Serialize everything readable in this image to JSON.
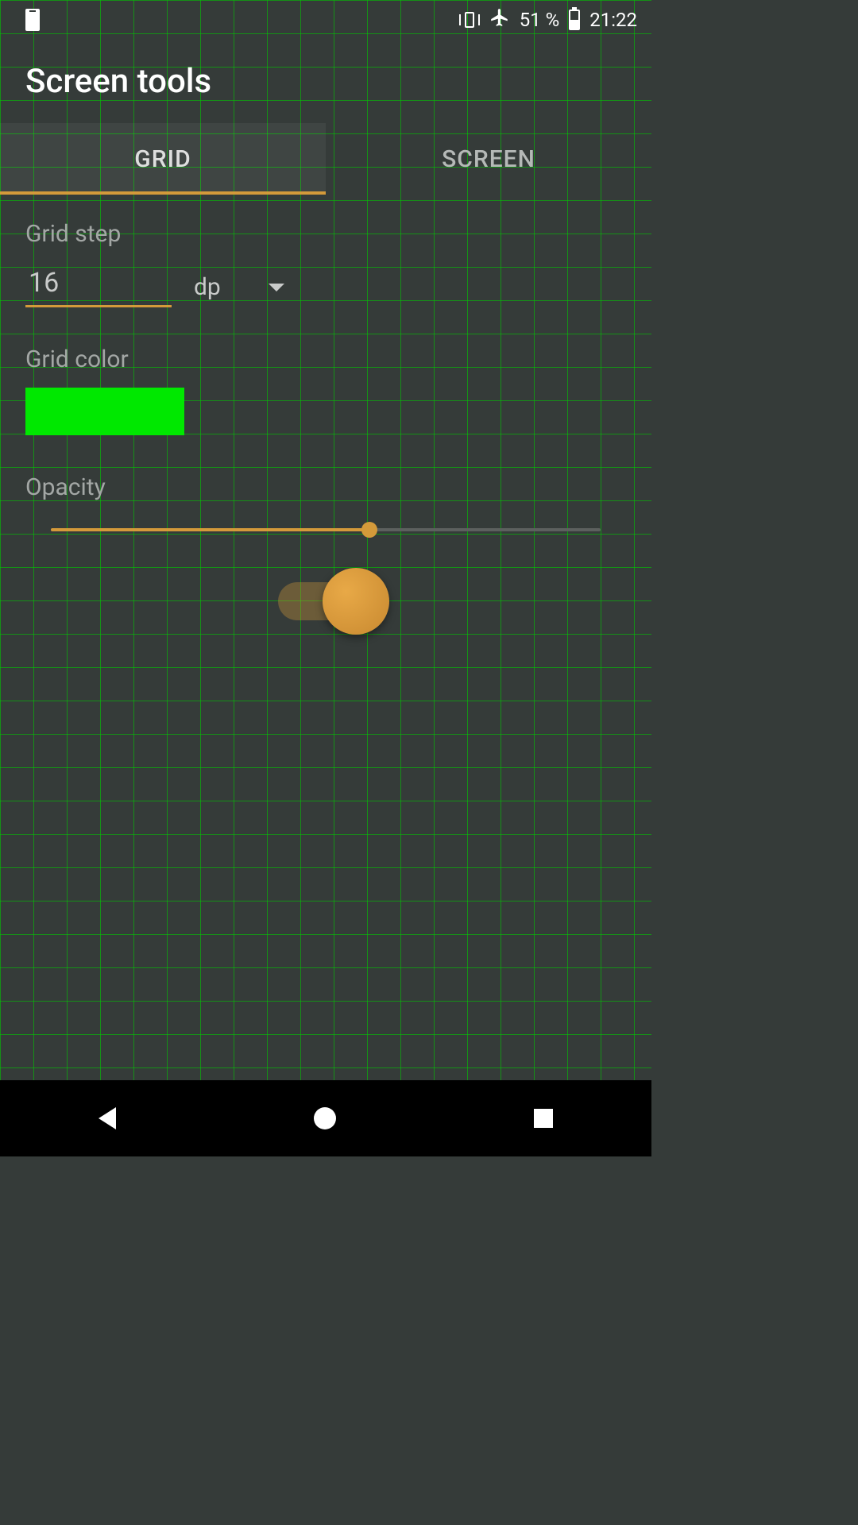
{
  "status_bar": {
    "battery_percent": "51 %",
    "time": "21:22"
  },
  "header": {
    "title": "Screen tools"
  },
  "tabs": [
    {
      "label": "GRID",
      "active": true
    },
    {
      "label": "SCREEN",
      "active": false
    }
  ],
  "grid_step": {
    "label": "Grid step",
    "value": "16",
    "unit": "dp"
  },
  "grid_color": {
    "label": "Grid color",
    "value": "#00E800"
  },
  "opacity": {
    "label": "Opacity",
    "percent": 58
  },
  "toggle": {
    "on": true
  },
  "colors": {
    "accent": "#d49a3a",
    "grid_overlay": "#00c800"
  }
}
